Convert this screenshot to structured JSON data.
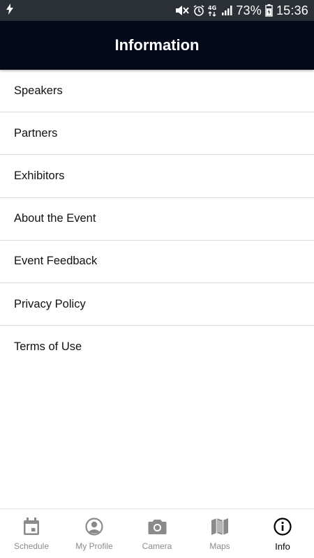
{
  "status_bar": {
    "battery": "73%",
    "time": "15:36",
    "network": "4G",
    "icons": [
      "flash-icon",
      "mute-icon",
      "alarm-icon",
      "data-icon",
      "signal-icon",
      "battery-icon"
    ]
  },
  "header": {
    "title": "Information"
  },
  "menu": {
    "items": [
      {
        "label": "Speakers"
      },
      {
        "label": "Partners"
      },
      {
        "label": "Exhibitors"
      },
      {
        "label": "About the Event"
      },
      {
        "label": "Event Feedback"
      },
      {
        "label": "Privacy Policy"
      },
      {
        "label": "Terms of Use"
      }
    ]
  },
  "bottom_nav": {
    "active": "Info",
    "items": [
      {
        "label": "Schedule",
        "icon": "calendar-icon"
      },
      {
        "label": "My Profile",
        "icon": "profile-icon"
      },
      {
        "label": "Camera",
        "icon": "camera-icon"
      },
      {
        "label": "Maps",
        "icon": "map-icon"
      },
      {
        "label": "Info",
        "icon": "info-icon"
      }
    ]
  },
  "colors": {
    "header_bg": "#04091a",
    "status_bg": "#2b2f36",
    "inactive_nav": "#8a8a8a",
    "active_nav": "#000000"
  }
}
